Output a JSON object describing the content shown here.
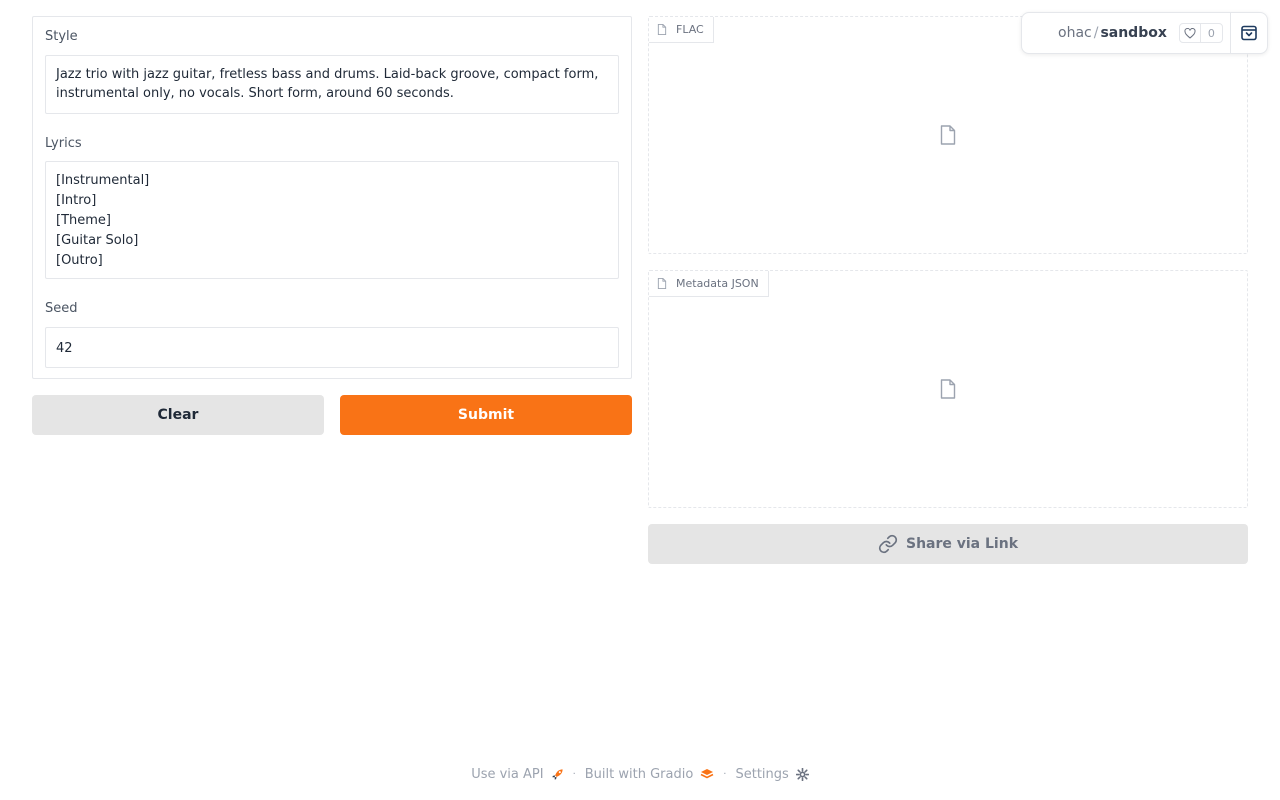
{
  "form": {
    "style": {
      "label": "Style",
      "value": "Jazz trio with jazz guitar, fretless bass and drums. Laid-back groove, compact form, instrumental only, no vocals. Short form, around 60 seconds."
    },
    "lyrics": {
      "label": "Lyrics",
      "lines": [
        "[Instrumental]",
        "[Intro]",
        "[Theme]",
        "[Guitar Solo]",
        "[Outro]"
      ]
    },
    "seed": {
      "label": "Seed",
      "value": "42"
    }
  },
  "buttons": {
    "clear": "Clear",
    "submit": "Submit",
    "share": "Share via Link"
  },
  "outputs": {
    "flac_label": "FLAC",
    "metadata_label": "Metadata JSON"
  },
  "space_badge": {
    "owner": "ohac",
    "separator": "/",
    "space": "sandbox",
    "likes": "0"
  },
  "footer": {
    "api": "Use via API",
    "built": "Built with Gradio",
    "settings": "Settings"
  },
  "colors": {
    "accent": "#f97316",
    "button_secondary": "#e5e5e5",
    "border": "#e5e7eb"
  },
  "icons": [
    "file-icon",
    "link-icon",
    "heart-icon",
    "collapse-icon",
    "rocket-icon",
    "gradio-logo-icon",
    "gear-icon"
  ]
}
